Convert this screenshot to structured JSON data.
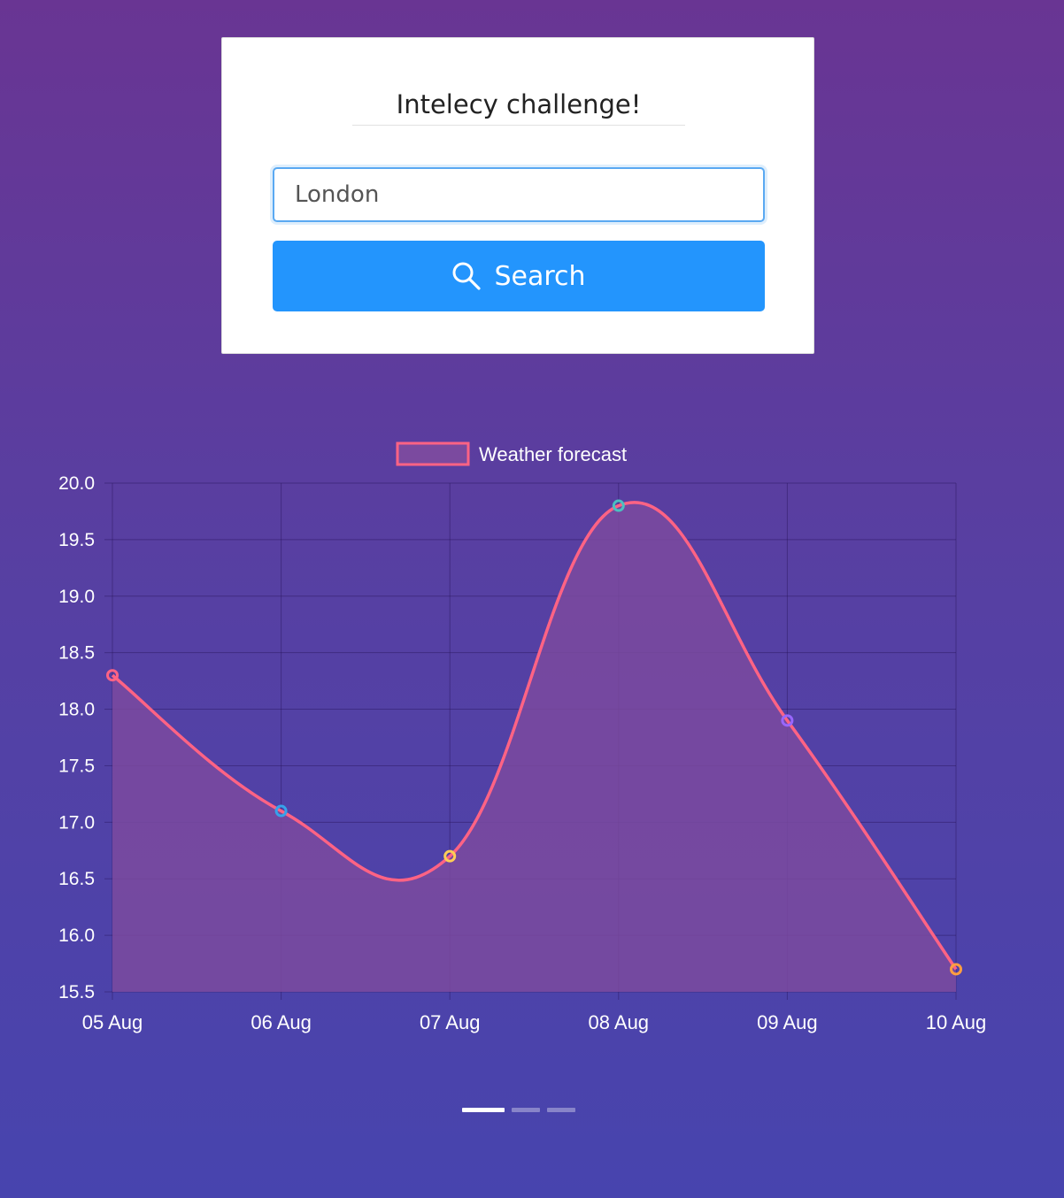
{
  "card": {
    "title": "Intelecy challenge!",
    "input_value": "London",
    "search_label": "Search"
  },
  "chart_data": {
    "type": "area",
    "title": "",
    "xlabel": "",
    "ylabel": "",
    "legend": {
      "position": "top",
      "label": "Weather forecast"
    },
    "categories": [
      "05 Aug",
      "06 Aug",
      "07 Aug",
      "08 Aug",
      "09 Aug",
      "10 Aug"
    ],
    "series": [
      {
        "name": "Weather forecast",
        "values": [
          18.3,
          17.1,
          16.7,
          19.8,
          17.9,
          15.7
        ],
        "line_color": "#ff6384",
        "fill_color": "#7b4a9f",
        "point_colors": [
          "#ff6384",
          "#36a2eb",
          "#ffce56",
          "#4bc0c0",
          "#9966ff",
          "#ff9f40"
        ]
      }
    ],
    "ylim": [
      15.5,
      20.0
    ],
    "yticks": [
      "20.0",
      "19.5",
      "19.0",
      "18.5",
      "18.0",
      "17.5",
      "17.0",
      "16.5",
      "16.0",
      "15.5"
    ],
    "grid": true
  },
  "pager": {
    "count": 3,
    "active": 0
  },
  "colors": {
    "button": "#2395fd",
    "input_border": "#5aa9f2"
  }
}
